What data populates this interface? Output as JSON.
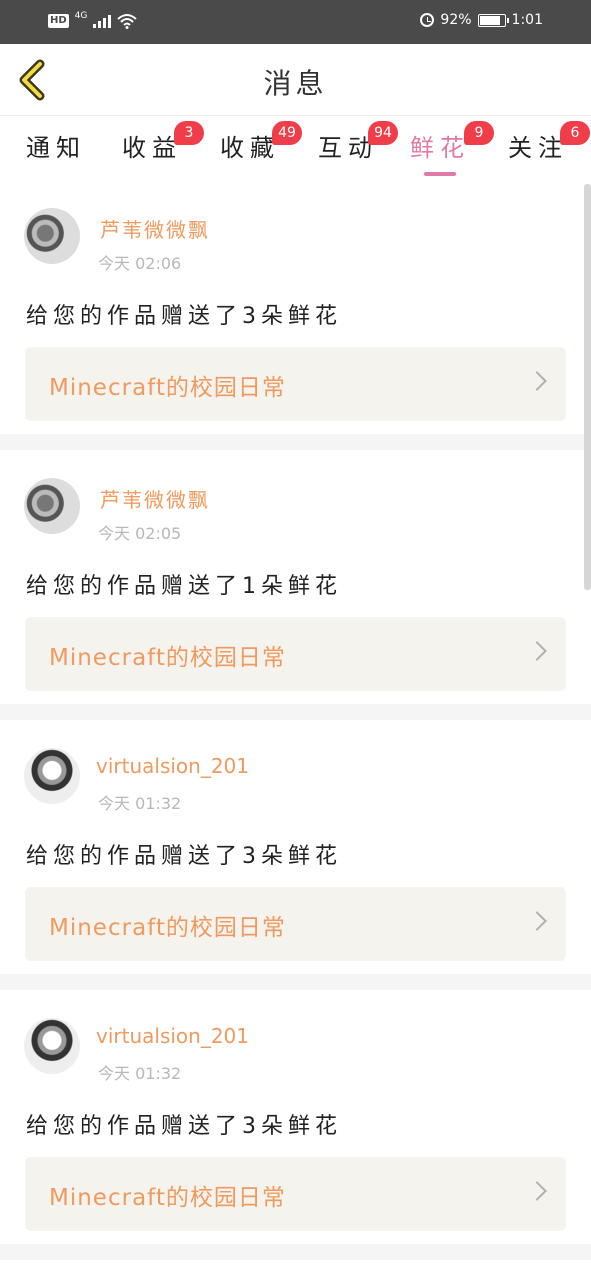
{
  "status_bar": {
    "hd": "HD",
    "network": "4G",
    "battery_percent": "92%",
    "battery_level": 0.92,
    "time": "1:01"
  },
  "header": {
    "title": "消息",
    "back_icon": "chevron-left-icon"
  },
  "tabs": [
    {
      "label": "通知",
      "badge": ""
    },
    {
      "label": "收益",
      "badge": "3"
    },
    {
      "label": "收藏",
      "badge": "49"
    },
    {
      "label": "互动",
      "badge": "94"
    },
    {
      "label": "鲜花",
      "badge": "9",
      "active": true
    },
    {
      "label": "关注",
      "badge": "6"
    }
  ],
  "messages": [
    {
      "user": "芦苇微微飘",
      "time": "今天 02:06",
      "text": "给您的作品赠送了3朵鲜花",
      "work": "Minecraft的校园日常"
    },
    {
      "user": "芦苇微微飘",
      "time": "今天 02:05",
      "text": "给您的作品赠送了1朵鲜花",
      "work": "Minecraft的校园日常"
    },
    {
      "user": "virtualsion_201",
      "time": "今天 01:32",
      "text": "给您的作品赠送了3朵鲜花",
      "work": "Minecraft的校园日常"
    },
    {
      "user": "virtualsion_201",
      "time": "今天 01:32",
      "text": "给您的作品赠送了3朵鲜花",
      "work": "Minecraft的校园日常"
    }
  ],
  "colors": {
    "accent_pink": "#e07aa7",
    "username_orange": "#ef9a5e",
    "badge_red": "#f03d4a",
    "link_bg": "#f4f3ee"
  }
}
